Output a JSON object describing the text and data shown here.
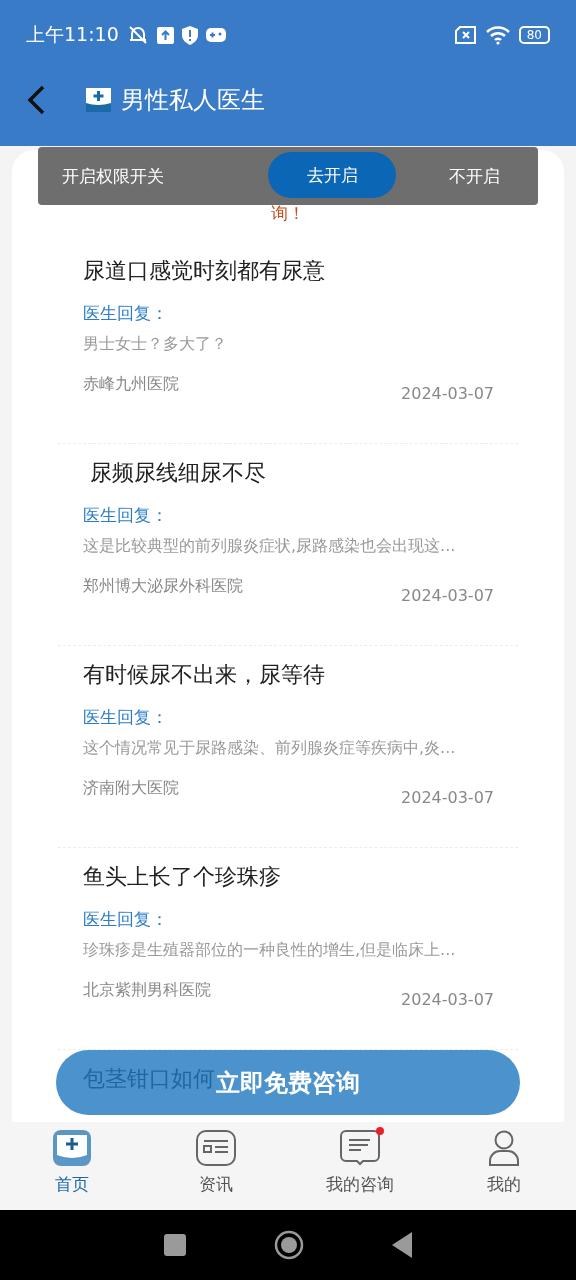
{
  "status_bar": {
    "time": "上午11:10",
    "battery": "80"
  },
  "header": {
    "title": "男性私人医生"
  },
  "notice": {
    "text": "询！"
  },
  "permission_toast": {
    "message": "开启权限开关",
    "confirm": "去开启",
    "dismiss": "不开启"
  },
  "questions": [
    {
      "title": "尿道口感觉时刻都有尿意",
      "reply_label": "医生回复：",
      "reply": "男士女士？多大了？",
      "hospital": "赤峰九州医院",
      "date": "2024-03-07"
    },
    {
      "title": " 尿频尿线细尿不尽",
      "reply_label": "医生回复：",
      "reply": "这是比较典型的前列腺炎症状,尿路感染也会出现这...",
      "hospital": "郑州博大泌尿外科医院",
      "date": "2024-03-07"
    },
    {
      "title": "有时候尿不出来，尿等待",
      "reply_label": "医生回复：",
      "reply": "这个情况常见于尿路感染、前列腺炎症等疾病中,炎...",
      "hospital": "济南附大医院",
      "date": "2024-03-07"
    },
    {
      "title": "鱼头上长了个珍珠疹",
      "reply_label": "医生回复：",
      "reply": "珍珠疹是生殖器部位的一种良性的增生,但是临床上...",
      "hospital": "北京紫荆男科医院",
      "date": "2024-03-07"
    },
    {
      "title": "包茎钳口如何"
    }
  ],
  "consult_button": "立即免费咨询",
  "tabs": [
    {
      "kind": "home",
      "label": "首页",
      "selected": true,
      "badge": false
    },
    {
      "kind": "news",
      "label": "资讯",
      "selected": false,
      "badge": false
    },
    {
      "kind": "chat",
      "label": "我的咨询",
      "selected": false,
      "badge": true
    },
    {
      "kind": "person",
      "label": "我的",
      "selected": false,
      "badge": false
    }
  ]
}
